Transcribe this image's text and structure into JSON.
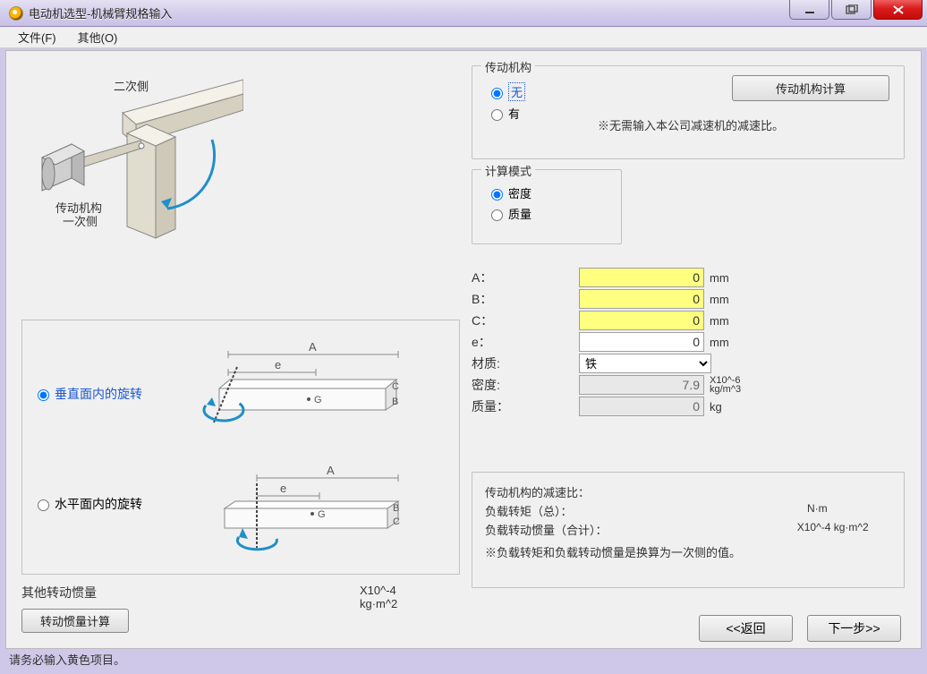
{
  "window": {
    "title": "电动机选型-机械臂规格输入"
  },
  "menu": {
    "file": "文件(F)",
    "other": "其他(O)"
  },
  "diagram": {
    "label_secondary": "二次側",
    "label_primary1": "传动机构",
    "label_primary2": "一次侧"
  },
  "transmission": {
    "legend": "传动机构",
    "opt_none": "无",
    "opt_has": "有",
    "calc_label": "传动机构计算",
    "note": "※无需输入本公司减速机的减速比。"
  },
  "calc_mode": {
    "legend": "计算模式",
    "opt_density": "密度",
    "opt_mass": "质量"
  },
  "rotation": {
    "opt_vertical": "垂直面内的旋转",
    "opt_horizontal": "水平面内的旋转"
  },
  "fields": {
    "a_label": "A：",
    "a_value": "0",
    "a_unit": "mm",
    "b_label": "B：",
    "b_value": "0",
    "b_unit": "mm",
    "c_label": "C：",
    "c_value": "0",
    "c_unit": "mm",
    "e_label": "e：",
    "e_value": "0",
    "e_unit": "mm",
    "material_label": "材质:",
    "material_value": "铁",
    "density_label": "密度:",
    "density_value": "7.9",
    "density_unit": "X10^-6 kg/m^3",
    "mass_label": "质量：",
    "mass_value": "0",
    "mass_unit": "kg"
  },
  "output": {
    "ratio_label": "传动机构的减速比：",
    "torque_label": "负载转矩（总）：",
    "torque_unit": "N·m",
    "inertia_label": "负载转动惯量（合计）：",
    "inertia_unit": "X10^-4 kg·m^2",
    "note": "※负载转矩和负载转动惯量是换算为一次侧的值。"
  },
  "other_inertia": {
    "label": "其他转动惯量",
    "unit": "X10^-4 kg·m^2",
    "calc_label": "转动惯量计算"
  },
  "nav": {
    "back": "<<返回",
    "next": "下一步>>"
  },
  "status": "请务必输入黄色项目。"
}
